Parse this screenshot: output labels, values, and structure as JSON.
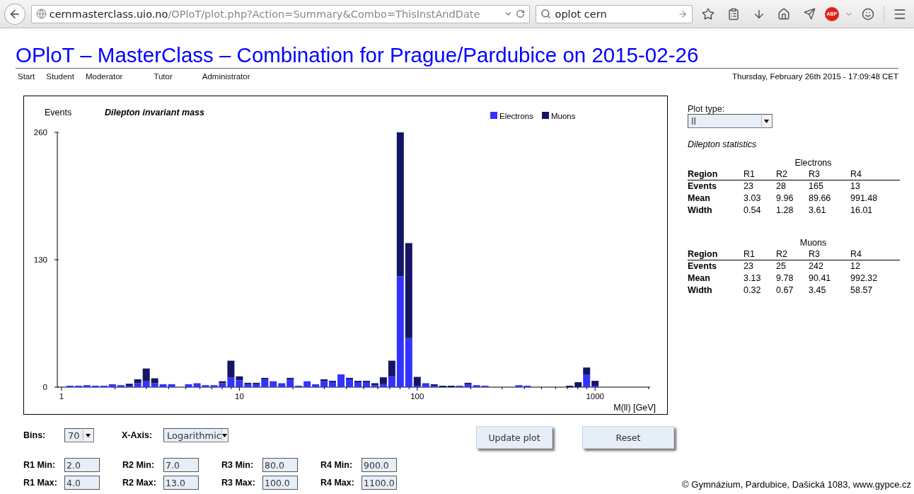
{
  "browser": {
    "url_host": "cernmasterclass.uio.no",
    "url_path": "/OPloT/plot.php?Action=Summary&Combo=ThisInstAndDate",
    "search_value": "oplot cern",
    "adblock_label": "ABP"
  },
  "page": {
    "title": "OPloT – MasterClass – Combination for Prague/Pardubice on 2015-02-26",
    "nav": [
      {
        "label": "Start"
      },
      {
        "label": "Student"
      },
      {
        "label": "Moderator"
      },
      {
        "label": "Tutor"
      },
      {
        "label": "Administrator"
      }
    ],
    "timestamp": "Thursday, February 26th 2015 - 17:09:48 CET"
  },
  "plot": {
    "chart_data": {
      "type": "bar",
      "title": "Dilepton invariant mass",
      "xlabel": "M(ll) [GeV]",
      "ylabel": "Events",
      "stacked": true,
      "legend": true,
      "categories": [
        "1",
        null,
        null,
        null,
        null,
        null,
        null,
        null,
        null,
        null,
        null,
        null,
        null,
        null,
        null,
        null,
        null,
        null,
        null,
        null,
        null,
        "10",
        null,
        null,
        null,
        null,
        null,
        null,
        null,
        null,
        null,
        null,
        null,
        null,
        null,
        null,
        null,
        null,
        null,
        null,
        null,
        null,
        "100",
        null,
        null,
        null,
        null,
        null,
        null,
        null,
        null,
        null,
        null,
        null,
        null,
        null,
        null,
        null,
        null,
        null,
        null,
        null,
        null,
        "1000",
        null,
        null,
        null,
        null,
        null,
        null
      ],
      "ylim": [
        0,
        260
      ],
      "yticks": [
        0,
        130,
        260
      ],
      "series": [
        {
          "name": "Electrons",
          "color": "#3333ff",
          "values": [
            0,
            1,
            1,
            2,
            1,
            1,
            3,
            2,
            1,
            4,
            6,
            4,
            3,
            3,
            0,
            3,
            4,
            2,
            2,
            4,
            10,
            7,
            3,
            3,
            8,
            6,
            4,
            8,
            1,
            6,
            3,
            6,
            5,
            13,
            8,
            5,
            5,
            2,
            3,
            11,
            113,
            50,
            1,
            4,
            1,
            0,
            0,
            1,
            3,
            2,
            1,
            0,
            0,
            0,
            2,
            1,
            0,
            0,
            0,
            0,
            0,
            0,
            13,
            1,
            0,
            0,
            0,
            0,
            0,
            0
          ]
        },
        {
          "name": "Muons",
          "color": "#151565",
          "values": [
            0,
            0,
            0,
            0,
            0,
            0,
            0,
            0,
            2,
            4,
            13,
            5,
            0,
            0,
            0,
            0,
            0,
            0,
            0,
            2,
            17,
            4,
            1,
            1,
            1,
            0,
            0,
            1,
            0,
            0,
            0,
            2,
            1,
            0,
            1,
            1,
            1,
            2,
            7,
            16,
            147,
            97,
            9,
            0,
            1,
            1,
            1,
            0,
            1,
            0,
            0,
            0,
            0,
            0,
            0,
            0,
            0,
            0,
            0,
            0,
            1,
            5,
            7,
            5,
            0,
            0,
            0,
            0,
            0,
            0
          ]
        }
      ]
    }
  },
  "controls": {
    "bins": {
      "label": "Bins:",
      "value": "70"
    },
    "x_axis": {
      "label": "X-Axis:",
      "value": "Logarithmic"
    },
    "regions": [
      {
        "min_label": "R1 Min:",
        "min_value": "2.0",
        "max_label": "R1 Max:",
        "max_value": "4.0"
      },
      {
        "min_label": "R2 Min:",
        "min_value": "7.0",
        "max_label": "R2 Max:",
        "max_value": "13.0"
      },
      {
        "min_label": "R3 Min:",
        "min_value": "80.0",
        "max_label": "R3 Max:",
        "max_value": "100.0"
      },
      {
        "min_label": "R4 Min:",
        "min_value": "900.0",
        "max_label": "R4 Max:",
        "max_value": "1100.0"
      }
    ],
    "buttons": [
      {
        "label": "Update plot"
      },
      {
        "label": "Reset"
      }
    ]
  },
  "sidebar": {
    "plot_type": {
      "label": "Plot type:",
      "value": "ll"
    },
    "stats_title": "Dilepton statistics",
    "tables": [
      {
        "name": "Electrons",
        "columns": [
          "Region",
          "R1",
          "R2",
          "R3",
          "R4"
        ],
        "rows": [
          [
            "Events",
            "23",
            "28",
            "165",
            "13"
          ],
          [
            "Mean",
            "3.03",
            "9.96",
            "89.66",
            "991.48"
          ],
          [
            "Width",
            "0.54",
            "1.28",
            "3.61",
            "16.01"
          ]
        ]
      },
      {
        "name": "Muons",
        "columns": [
          "Region",
          "R1",
          "R2",
          "R3",
          "R4"
        ],
        "rows": [
          [
            "Events",
            "23",
            "25",
            "242",
            "12"
          ],
          [
            "Mean",
            "3.13",
            "9.78",
            "90.41",
            "992.32"
          ],
          [
            "Width",
            "0.32",
            "0.67",
            "3.45",
            "58.57"
          ]
        ]
      }
    ]
  },
  "footer": "© Gymnázium, Pardubice, Dašická 1083, www.gypce.cz"
}
